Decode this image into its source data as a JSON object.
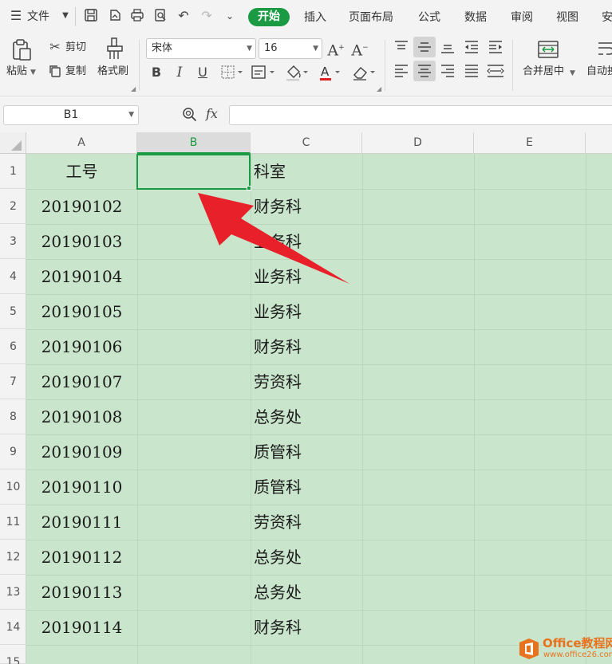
{
  "menubar": {
    "file_label": "文件",
    "tabs": [
      {
        "label": "开始",
        "active": true
      },
      {
        "label": "插入"
      },
      {
        "label": "页面布局"
      },
      {
        "label": "公式"
      },
      {
        "label": "数据"
      },
      {
        "label": "审阅"
      },
      {
        "label": "视图"
      },
      {
        "label": "安"
      }
    ]
  },
  "ribbon": {
    "paste_label": "粘贴",
    "cut_label": "剪切",
    "copy_label": "复制",
    "format_painter_label": "格式刷",
    "font_name": "宋体",
    "font_size": "16",
    "merge_center_label": "合并居中",
    "auto_wrap_label": "自动换"
  },
  "formula_bar": {
    "name_box": "B1",
    "fx_label": "fx",
    "formula": ""
  },
  "sheet": {
    "columns": [
      "A",
      "B",
      "C",
      "D",
      "E"
    ],
    "selected_column": "B",
    "selected_cell": "B1",
    "rows": [
      {
        "num": "1",
        "a": "工号",
        "c": "科室"
      },
      {
        "num": "2",
        "a": "20190102",
        "c": "财务科"
      },
      {
        "num": "3",
        "a": "20190103",
        "c": "业务科"
      },
      {
        "num": "4",
        "a": "20190104",
        "c": "业务科"
      },
      {
        "num": "5",
        "a": "20190105",
        "c": "业务科"
      },
      {
        "num": "6",
        "a": "20190106",
        "c": "财务科"
      },
      {
        "num": "7",
        "a": "20190107",
        "c": "劳资科"
      },
      {
        "num": "8",
        "a": "20190108",
        "c": "总务处"
      },
      {
        "num": "9",
        "a": "20190109",
        "c": "质管科"
      },
      {
        "num": "10",
        "a": "20190110",
        "c": "质管科"
      },
      {
        "num": "11",
        "a": "20190111",
        "c": "劳资科"
      },
      {
        "num": "12",
        "a": "20190112",
        "c": "总务处"
      },
      {
        "num": "13",
        "a": "20190113",
        "c": "总务处"
      },
      {
        "num": "14",
        "a": "20190114",
        "c": "财务科"
      },
      {
        "num": "15",
        "a": "",
        "c": ""
      }
    ]
  },
  "watermark": {
    "name": "Office教程网",
    "url": "www.office26.com"
  },
  "colors": {
    "accent": "#1a9a43",
    "sheet_background": "#c9e5cc",
    "annotation_arrow": "#e8202a",
    "watermark": "#e8731f"
  }
}
